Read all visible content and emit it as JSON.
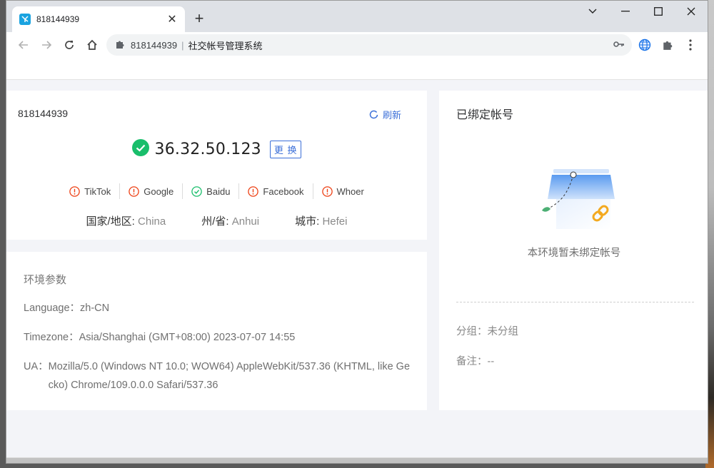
{
  "tab": {
    "title": "818144939"
  },
  "address": {
    "host": "818144939",
    "separator": "|",
    "path": "社交帐号管理系统"
  },
  "env": {
    "name": "818144939",
    "refresh_label": "刷新",
    "ip": "36.32.50.123",
    "change_label": "更 换",
    "checks": [
      {
        "label": "TikTok",
        "status": "error"
      },
      {
        "label": "Google",
        "status": "error"
      },
      {
        "label": "Baidu",
        "status": "ok"
      },
      {
        "label": "Facebook",
        "status": "error"
      },
      {
        "label": "Whoer",
        "status": "error"
      }
    ],
    "geo": {
      "country_key": "国家/地区:",
      "country": "China",
      "province_key": "州/省:",
      "province": "Anhui",
      "city_key": "城市:",
      "city": "Hefei"
    }
  },
  "params": {
    "title": "环境参数",
    "language_key": "Language：",
    "language": "zh-CN",
    "timezone_key": "Timezone：",
    "timezone": "Asia/Shanghai (GMT+08:00) 2023-07-07 14:55",
    "ua_key": "UA：",
    "ua": "Mozilla/5.0 (Windows NT 10.0; WOW64) AppleWebKit/537.36 (KHTML, like Gecko) Chrome/109.0.0.0 Safari/537.36"
  },
  "bound": {
    "title": "已绑定帐号",
    "empty_text": "本环境暂未绑定帐号",
    "group_key": "分组：",
    "group": "未分组",
    "note_key": "备注：",
    "note": "--"
  },
  "colors": {
    "accent": "#3b6fd8",
    "ok": "#19be6b",
    "error": "#ed4014"
  }
}
